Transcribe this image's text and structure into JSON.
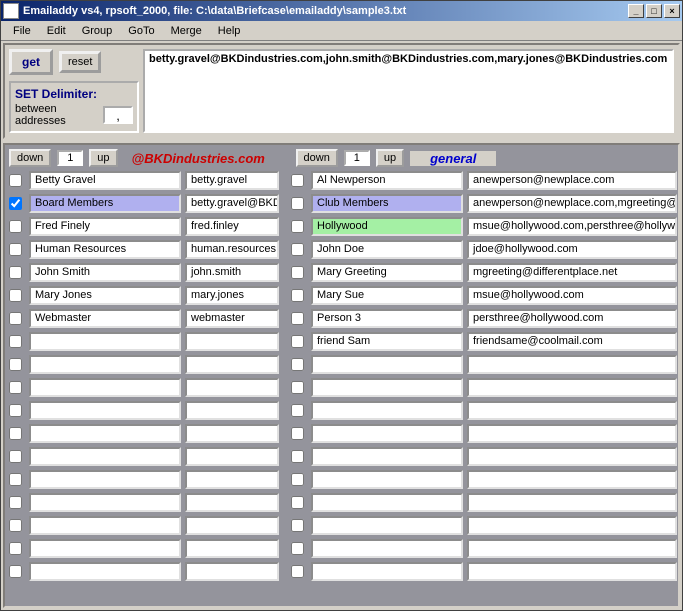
{
  "title": "Emailaddy vs4, rpsoft_2000, file:  C:\\data\\Briefcase\\emailaddy\\sample3.txt",
  "menus": [
    "File",
    "Edit",
    "Group",
    "GoTo",
    "Merge",
    "Help"
  ],
  "buttons": {
    "get": "get",
    "reset": "reset",
    "down": "down",
    "up": "up"
  },
  "delimiter": {
    "title": "SET Delimiter:",
    "label": "between addresses",
    "value": ","
  },
  "output": "betty.gravel@BKDindustries.com,john.smith@BKDindustries.com,mary.jones@BKDindustries.com",
  "navLeft": {
    "value": "1"
  },
  "navRight": {
    "value": "1"
  },
  "domainLabel": "@BKDindustries.com",
  "generalLabel": "general",
  "rows": [
    {
      "lchk": false,
      "lname": "Betty Gravel",
      "laddr": "betty.gravel",
      "lhl": "",
      "rchk": false,
      "rname": "Al Newperson",
      "raddr": "anewperson@newplace.com",
      "rhl": ""
    },
    {
      "lchk": true,
      "lname": "Board Members",
      "laddr": "betty.gravel@BKDi",
      "lhl": "blue",
      "rchk": false,
      "rname": "Club Members",
      "raddr": "anewperson@newplace.com,mgreeting@dif",
      "rhl": "blue"
    },
    {
      "lchk": false,
      "lname": "Fred Finely",
      "laddr": "fred.finley",
      "lhl": "",
      "rchk": false,
      "rname": "Hollywood",
      "raddr": "msue@hollywood.com,persthree@hollywood",
      "rhl": "green"
    },
    {
      "lchk": false,
      "lname": "Human Resources",
      "laddr": "human.resources",
      "lhl": "",
      "rchk": false,
      "rname": "John Doe",
      "raddr": "jdoe@hollywood.com",
      "rhl": ""
    },
    {
      "lchk": false,
      "lname": "John Smith",
      "laddr": "john.smith",
      "lhl": "",
      "rchk": false,
      "rname": "Mary Greeting",
      "raddr": "mgreeting@differentplace.net",
      "rhl": ""
    },
    {
      "lchk": false,
      "lname": "Mary Jones",
      "laddr": "mary.jones",
      "lhl": "",
      "rchk": false,
      "rname": "Mary Sue",
      "raddr": "msue@hollywood.com",
      "rhl": ""
    },
    {
      "lchk": false,
      "lname": "Webmaster",
      "laddr": "webmaster",
      "lhl": "",
      "rchk": false,
      "rname": "Person 3",
      "raddr": "persthree@hollywood.com",
      "rhl": ""
    },
    {
      "lchk": false,
      "lname": "",
      "laddr": "",
      "lhl": "",
      "rchk": false,
      "rname": "friend Sam",
      "raddr": "friendsame@coolmail.com",
      "rhl": ""
    },
    {
      "lchk": false,
      "lname": "",
      "laddr": "",
      "lhl": "",
      "rchk": false,
      "rname": "",
      "raddr": "",
      "rhl": ""
    },
    {
      "lchk": false,
      "lname": "",
      "laddr": "",
      "lhl": "",
      "rchk": false,
      "rname": "",
      "raddr": "",
      "rhl": ""
    },
    {
      "lchk": false,
      "lname": "",
      "laddr": "",
      "lhl": "",
      "rchk": false,
      "rname": "",
      "raddr": "",
      "rhl": ""
    },
    {
      "lchk": false,
      "lname": "",
      "laddr": "",
      "lhl": "",
      "rchk": false,
      "rname": "",
      "raddr": "",
      "rhl": ""
    },
    {
      "lchk": false,
      "lname": "",
      "laddr": "",
      "lhl": "",
      "rchk": false,
      "rname": "",
      "raddr": "",
      "rhl": ""
    },
    {
      "lchk": false,
      "lname": "",
      "laddr": "",
      "lhl": "",
      "rchk": false,
      "rname": "",
      "raddr": "",
      "rhl": ""
    },
    {
      "lchk": false,
      "lname": "",
      "laddr": "",
      "lhl": "",
      "rchk": false,
      "rname": "",
      "raddr": "",
      "rhl": ""
    },
    {
      "lchk": false,
      "lname": "",
      "laddr": "",
      "lhl": "",
      "rchk": false,
      "rname": "",
      "raddr": "",
      "rhl": ""
    },
    {
      "lchk": false,
      "lname": "",
      "laddr": "",
      "lhl": "",
      "rchk": false,
      "rname": "",
      "raddr": "",
      "rhl": ""
    },
    {
      "lchk": false,
      "lname": "",
      "laddr": "",
      "lhl": "",
      "rchk": false,
      "rname": "",
      "raddr": "",
      "rhl": ""
    }
  ]
}
